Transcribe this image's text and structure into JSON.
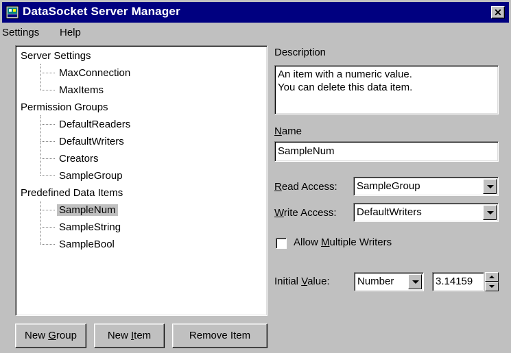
{
  "window": {
    "title": "DataSocket Server Manager",
    "close_glyph": "✕"
  },
  "menu": {
    "settings": "Settings",
    "help": "Help"
  },
  "tree": {
    "groups": [
      {
        "label": "Server Settings",
        "children": [
          "MaxConnection",
          "MaxItems"
        ]
      },
      {
        "label": "Permission Groups",
        "children": [
          "DefaultReaders",
          "DefaultWriters",
          "Creators",
          "SampleGroup"
        ]
      },
      {
        "label": "Predefined Data Items",
        "children": [
          "SampleNum",
          "SampleString",
          "SampleBool"
        ]
      }
    ],
    "selected": "SampleNum"
  },
  "buttons": {
    "new_group": {
      "pre": "New ",
      "u": "G",
      "post": "roup"
    },
    "new_item": {
      "pre": "New ",
      "u": "I",
      "post": "tem"
    },
    "remove_item": "Remove Item"
  },
  "details": {
    "description_label": "Description",
    "description_lines": [
      "An item with a numeric value.",
      "You can delete this data item."
    ],
    "name_label": {
      "u": "N",
      "post": "ame"
    },
    "name_value": "SampleNum",
    "read_access_label": {
      "u": "R",
      "post": "ead Access:"
    },
    "read_access_value": "SampleGroup",
    "write_access_label": {
      "u": "W",
      "post": "rite Access:"
    },
    "write_access_value": "DefaultWriters",
    "allow_multiple_writers": {
      "pre": "Allow ",
      "u": "M",
      "post": "ultiple Writers",
      "checked": false
    },
    "initial_value_label": {
      "pre": "Initial ",
      "u": "V",
      "post": "alue:"
    },
    "initial_value_type": "Number",
    "initial_value": "3.14159"
  }
}
